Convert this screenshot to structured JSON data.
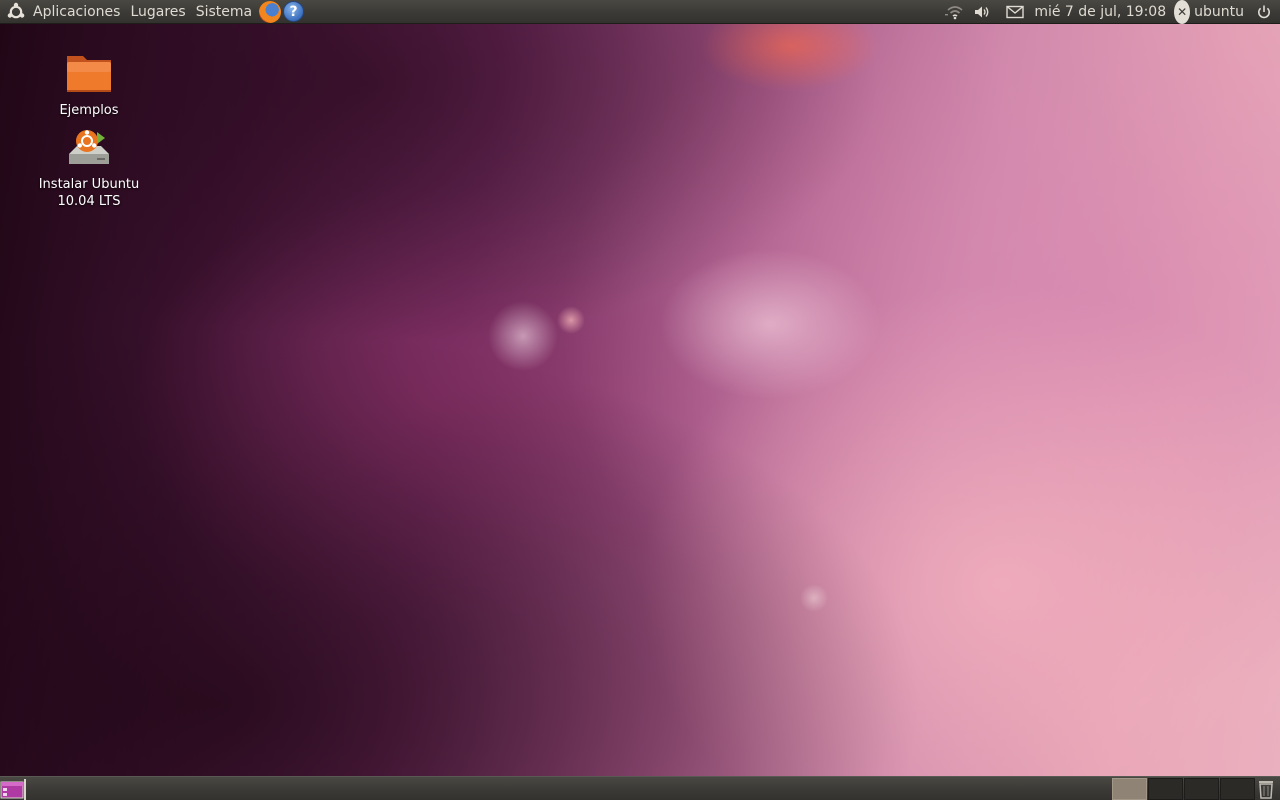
{
  "top_panel": {
    "menus": [
      "Aplicaciones",
      "Lugares",
      "Sistema"
    ],
    "help_glyph": "?",
    "clock": "mié  7 de jul, 19:08",
    "user": "ubuntu",
    "icons": [
      "ubuntu-logo-icon",
      "firefox-icon",
      "help-icon",
      "network-wireless-icon",
      "volume-icon",
      "mail-icon",
      "user-status-icon",
      "power-icon"
    ]
  },
  "desktop": {
    "items": [
      {
        "label": "Ejemplos",
        "icon": "folder-icon"
      },
      {
        "label": "Instalar Ubuntu 10.04 LTS",
        "icon": "installer-icon"
      }
    ],
    "wallpaper_colors": [
      "#2b0c1e",
      "#6a2958",
      "#d08aab",
      "#f66e5f"
    ]
  },
  "bottom_panel": {
    "workspaces": [
      {
        "active": true
      },
      {
        "active": false
      },
      {
        "active": false
      },
      {
        "active": false
      }
    ],
    "icons": [
      "show-desktop-icon",
      "trash-icon"
    ]
  }
}
